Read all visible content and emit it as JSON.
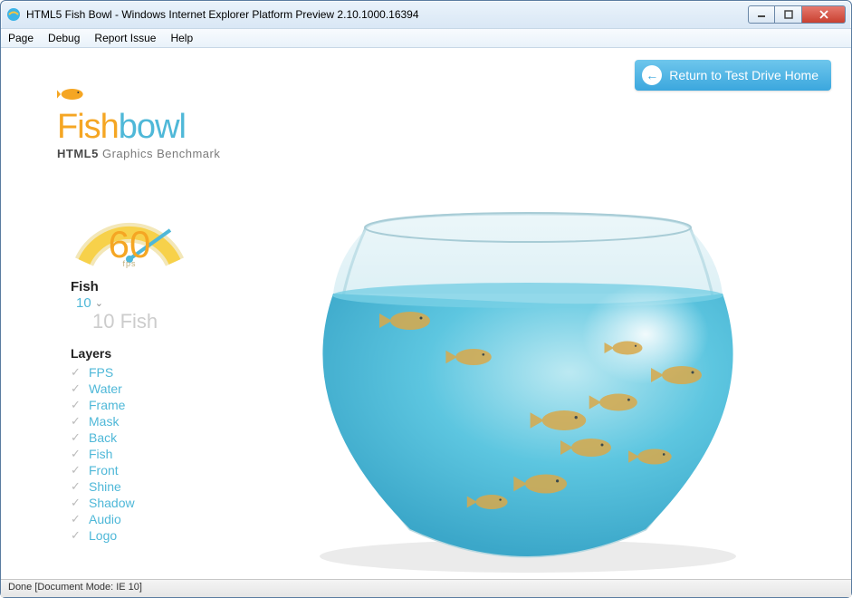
{
  "window": {
    "title": "HTML5 Fish Bowl - Windows Internet Explorer Platform Preview 2.10.1000.16394"
  },
  "menu": {
    "items": [
      "Page",
      "Debug",
      "Report Issue",
      "Help"
    ]
  },
  "return_button": {
    "label": "Return to Test Drive Home"
  },
  "logo": {
    "part1": "Fish",
    "part2": "bowl",
    "subtitle_strong": "HTML5",
    "subtitle_rest": " Graphics Benchmark"
  },
  "gauge": {
    "fps_value": "60",
    "fps_unit": "fps"
  },
  "fish_control": {
    "label": "Fish",
    "selected": "10",
    "display": "10 Fish"
  },
  "layers": {
    "header": "Layers",
    "items": [
      "FPS",
      "Water",
      "Frame",
      "Mask",
      "Back",
      "Fish",
      "Front",
      "Shine",
      "Shadow",
      "Audio",
      "Logo"
    ]
  },
  "status": {
    "text": "Done [Document Mode: IE 10]"
  },
  "colors": {
    "accent_orange": "#f5a623",
    "accent_blue": "#4fb8d8",
    "water": "#5dc6e0"
  }
}
